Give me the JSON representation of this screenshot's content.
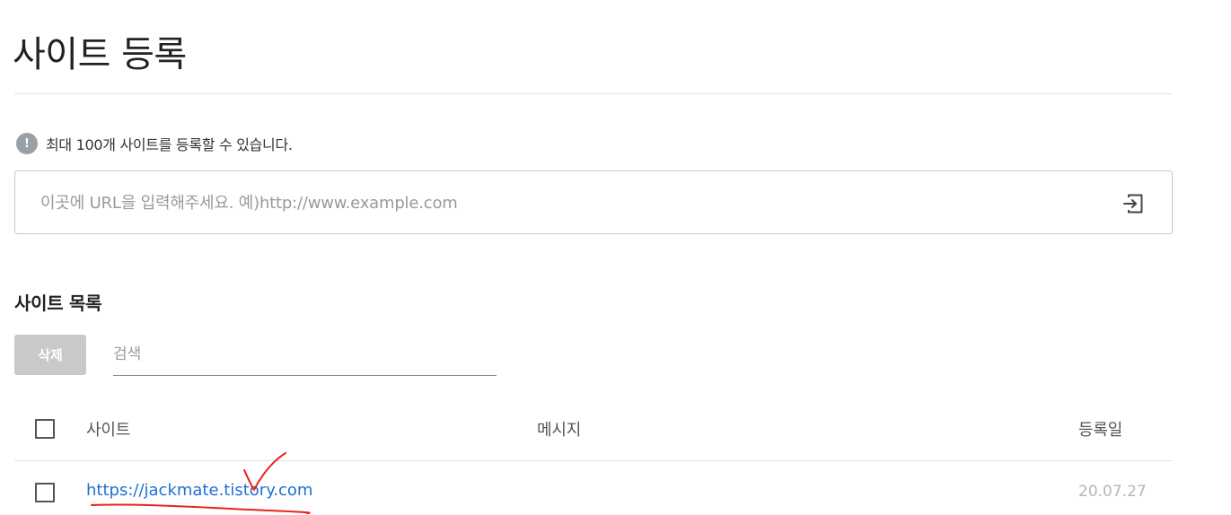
{
  "header": {
    "title": "사이트 등록"
  },
  "notice": {
    "icon": "exclamation-circle-icon",
    "icon_glyph": "!",
    "text": "최대 100개 사이트를 등록할 수 있습니다."
  },
  "url_input": {
    "placeholder": "이곳에 URL을 입력해주세요. 예)http://www.example.com",
    "value": "",
    "submit_icon": "enter-arrow-icon"
  },
  "site_list": {
    "title": "사이트 목록",
    "delete_label": "삭제",
    "search_placeholder": "검색",
    "columns": {
      "site": "사이트",
      "message": "메시지",
      "registered": "등록일"
    },
    "rows": [
      {
        "site": "https://jackmate.tistory.com",
        "message": "",
        "registered": "20.07.27",
        "checked": false
      }
    ]
  },
  "colors": {
    "link": "#1f6fd1",
    "annotation": "#e8231b",
    "disabled_button": "#c9c9c9"
  }
}
